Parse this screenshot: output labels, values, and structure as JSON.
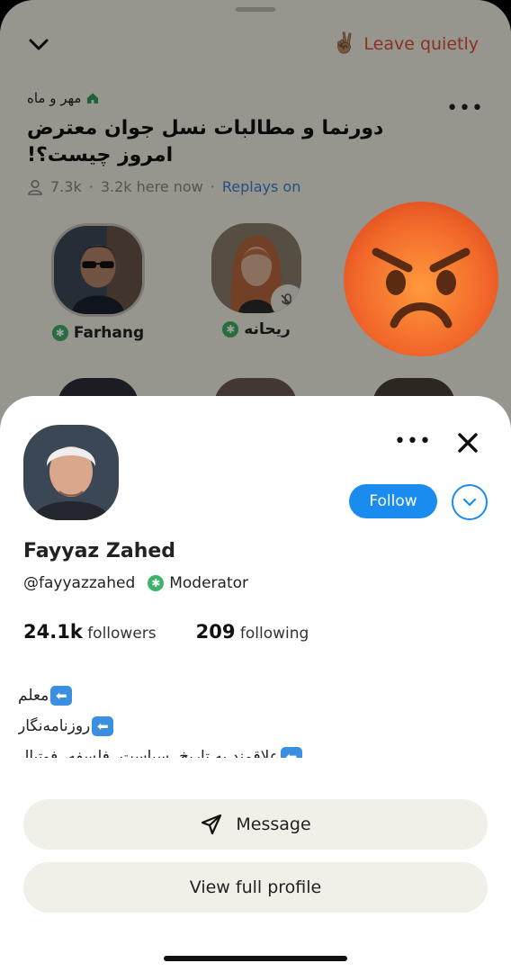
{
  "room": {
    "leave_label": "Leave quietly",
    "leave_emoji": "✌🏽",
    "club_name": "مهر و ماه",
    "title": "دورنما و مطالبات نسل جوان معترض امروز چیست؟!",
    "listeners": "7.3k",
    "here_now": "3.2k here now",
    "separator": "·",
    "replays": "Replays on"
  },
  "speakers": [
    {
      "name": "Farhang",
      "moderator": true
    },
    {
      "name": "ریحانه",
      "moderator": true,
      "muted": true
    }
  ],
  "reaction": {
    "emoji": "angry-face"
  },
  "profile": {
    "full_name": "Fayyaz Zahed",
    "handle": "@fayyazzahed",
    "role": "Moderator",
    "followers_count": "24.1k",
    "followers_label": "followers",
    "following_count": "209",
    "following_label": "following",
    "bio_lines": [
      "معلم",
      "روزنامه‌نگار",
      "علاقمند به تاریخ، سیاست، فلسفه، فوتبال"
    ],
    "follow_label": "Follow",
    "message_label": "Message",
    "view_profile_label": "View full profile"
  },
  "colors": {
    "accent": "#1a8cf0",
    "leave": "#e0503a",
    "moderator": "#3eb26a",
    "replays": "#3f7fd0"
  }
}
